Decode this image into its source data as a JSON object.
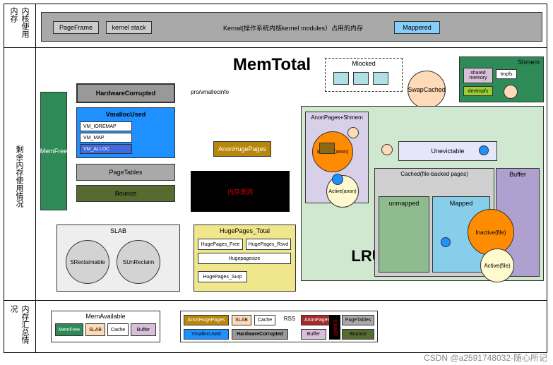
{
  "sect": {
    "s1": "内核使用内存",
    "s2": "剩余内存使用情况",
    "s3": "内存汇总情况"
  },
  "top": {
    "pf": "PageFrame",
    "ks": "kernel stack",
    "kn": "Kernal(操作系统内核kernel modules）占用的内存",
    "mp": "Mappered"
  },
  "title": "MemTotal",
  "ml": "Mlocked",
  "shm": {
    "t": "Shmem",
    "sm": "shared memory",
    "tm": "tmpfs",
    "dv": "devtmpfs"
  },
  "l": {
    "mf": "MemFree",
    "hc": "HardwareCorrupted",
    "pv": "pro/vmallocinfo",
    "vu": "VmallocUsed",
    "v1": "VM_IOREMAP",
    "v2": "VM_MAP",
    "v3": "VM_ALLOC",
    "pt": "PageTables",
    "bn": "Bounce",
    "bb": "内存黑洞",
    "ahp": "AnonHugePages"
  },
  "mid": {
    "aps": "AnonPages+Shmem",
    "ia": "Inactive(anon)",
    "aa": "Active(anon)",
    "sc": "SwapCached",
    "un": "Unevictable"
  },
  "r": {
    "cf": "Cached(file-backed pages)",
    "bf": "Buffer",
    "um": "unmapped",
    "mp": "Mapped",
    "if": "Inactive(file)",
    "af": "Active(file)",
    "lru": "LRU"
  },
  "slab": {
    "t": "SLAB",
    "sr": "SReclaimable",
    "su": "SUnReclaim"
  },
  "hp": {
    "t": "HugePages_Total",
    "f": "HugePages_Free",
    "r": "HugePages_Rsvd",
    "sz": "Hugepagesize",
    "sp": "HugePages_Surp"
  },
  "bot": {
    "ma": "MemAvailable",
    "mf": "MemFree",
    "sl": "SLAB",
    "ca": "Cache",
    "bf": "Buffer",
    "ah": "AnonHugePages",
    "vu": "VmallocUsed",
    "hc": "HardwareCorrupted",
    "rss": "RSS",
    "ap": "AnonPages",
    "pt": "PageTables",
    "bn": "Bounce",
    "bb": "内存黑洞"
  },
  "wm": "CSDN @a2591748032-随心所记"
}
